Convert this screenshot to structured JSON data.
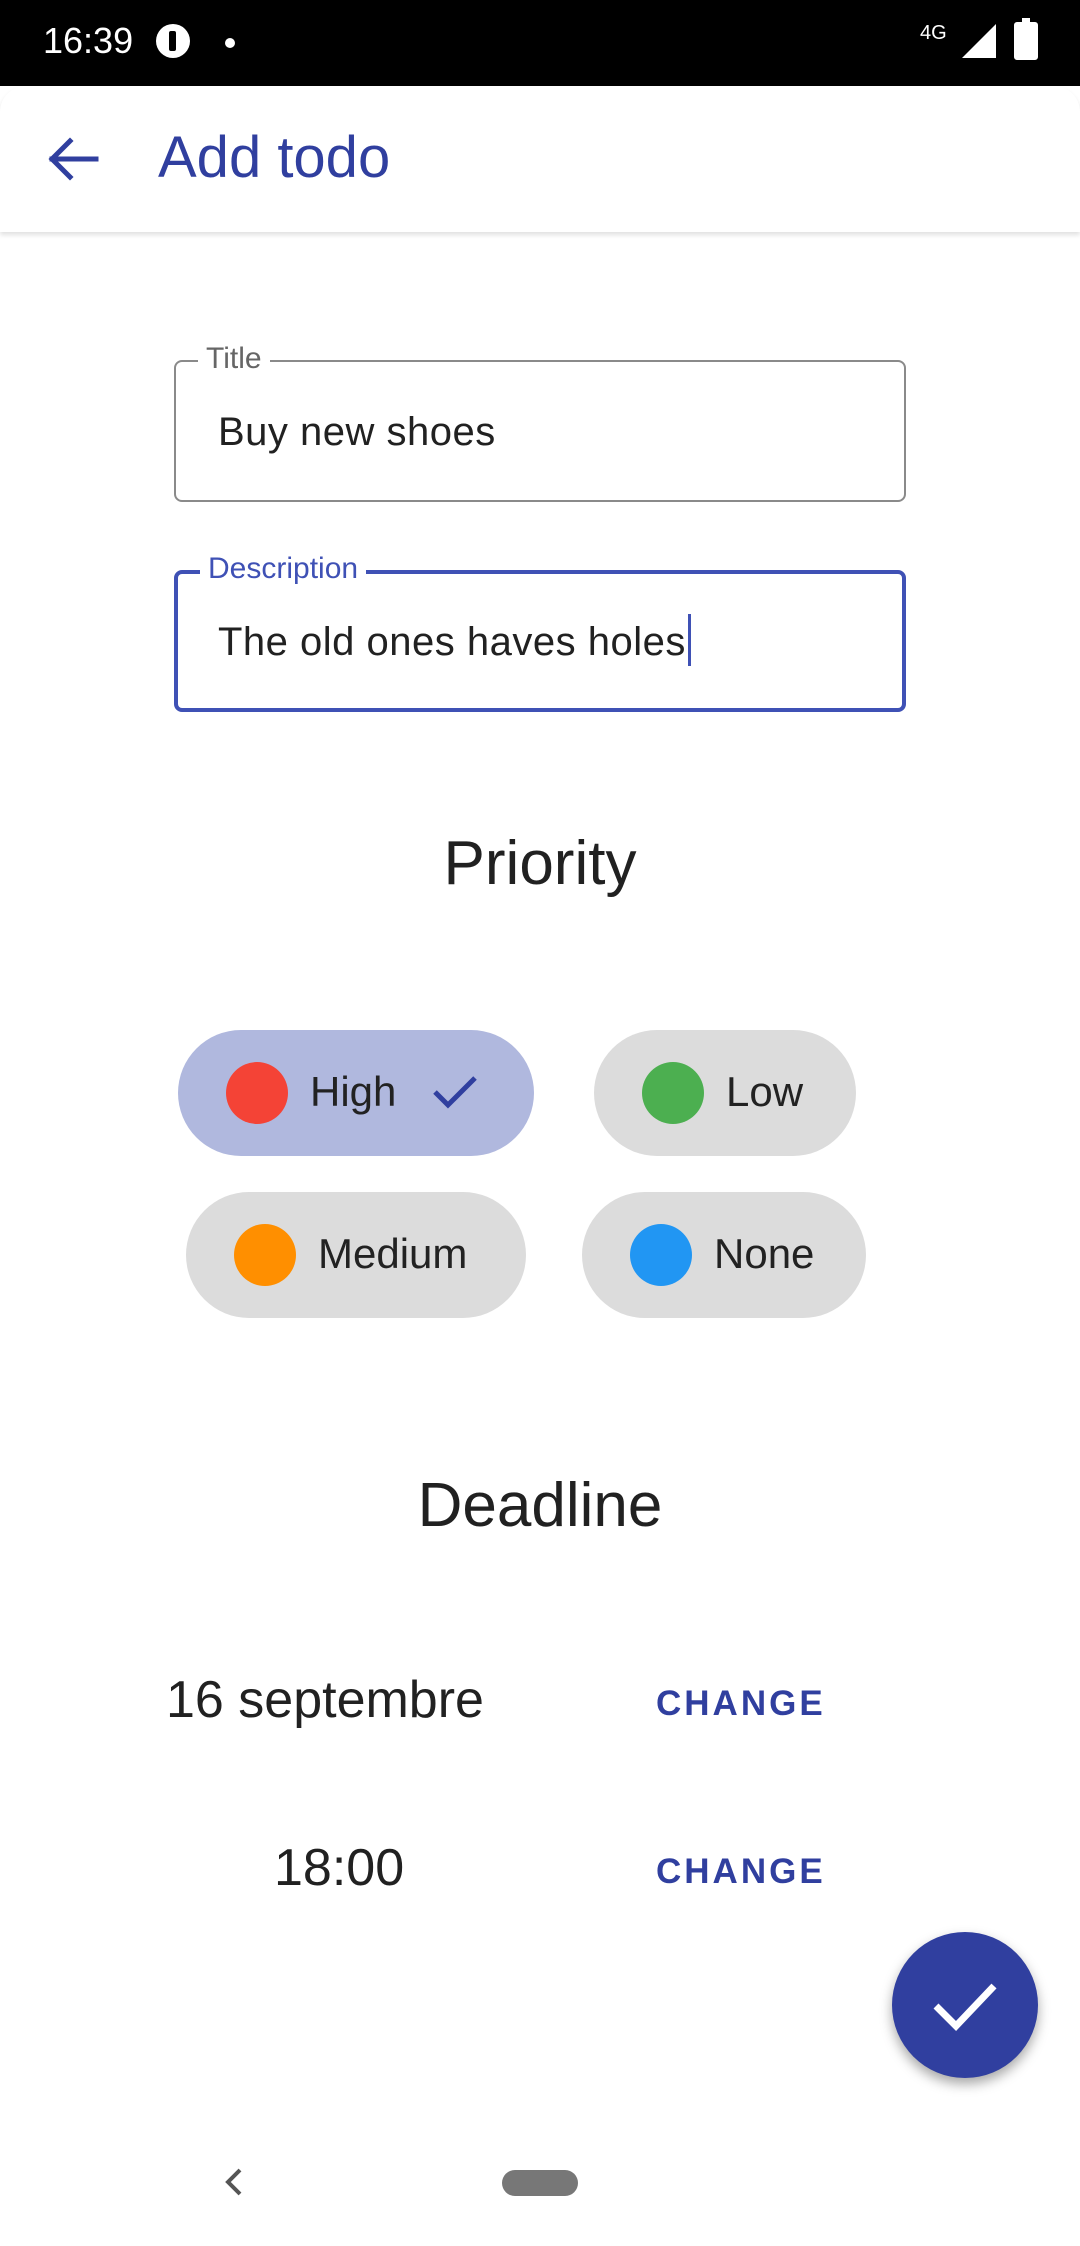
{
  "status_bar": {
    "time": "16:39",
    "network": "4G",
    "icons": [
      "app-notification-icon",
      "dot-icon",
      "signal-icon",
      "battery-charging-icon"
    ]
  },
  "app_bar": {
    "title": "Add todo",
    "back_icon": "arrow-back-icon"
  },
  "form": {
    "title_label": "Title",
    "title_value": "Buy new shoes",
    "description_label": "Description",
    "description_value": "The old ones haves holes"
  },
  "priority": {
    "heading": "Priority",
    "options": [
      {
        "label": "High",
        "color": "#f44336",
        "selected": true
      },
      {
        "label": "Low",
        "color": "#4caf50",
        "selected": false
      },
      {
        "label": "Medium",
        "color": "#ff8f00",
        "selected": false
      },
      {
        "label": "None",
        "color": "#2196f3",
        "selected": false
      }
    ]
  },
  "deadline": {
    "heading": "Deadline",
    "date": "16 septembre",
    "time": "18:00",
    "date_change_label": "CHANGE",
    "time_change_label": "CHANGE"
  },
  "fab": {
    "icon": "check-icon"
  },
  "colors": {
    "accent": "#303f9f",
    "chip_selected": "#b0b8de",
    "chip_default": "#dcdcdc"
  }
}
